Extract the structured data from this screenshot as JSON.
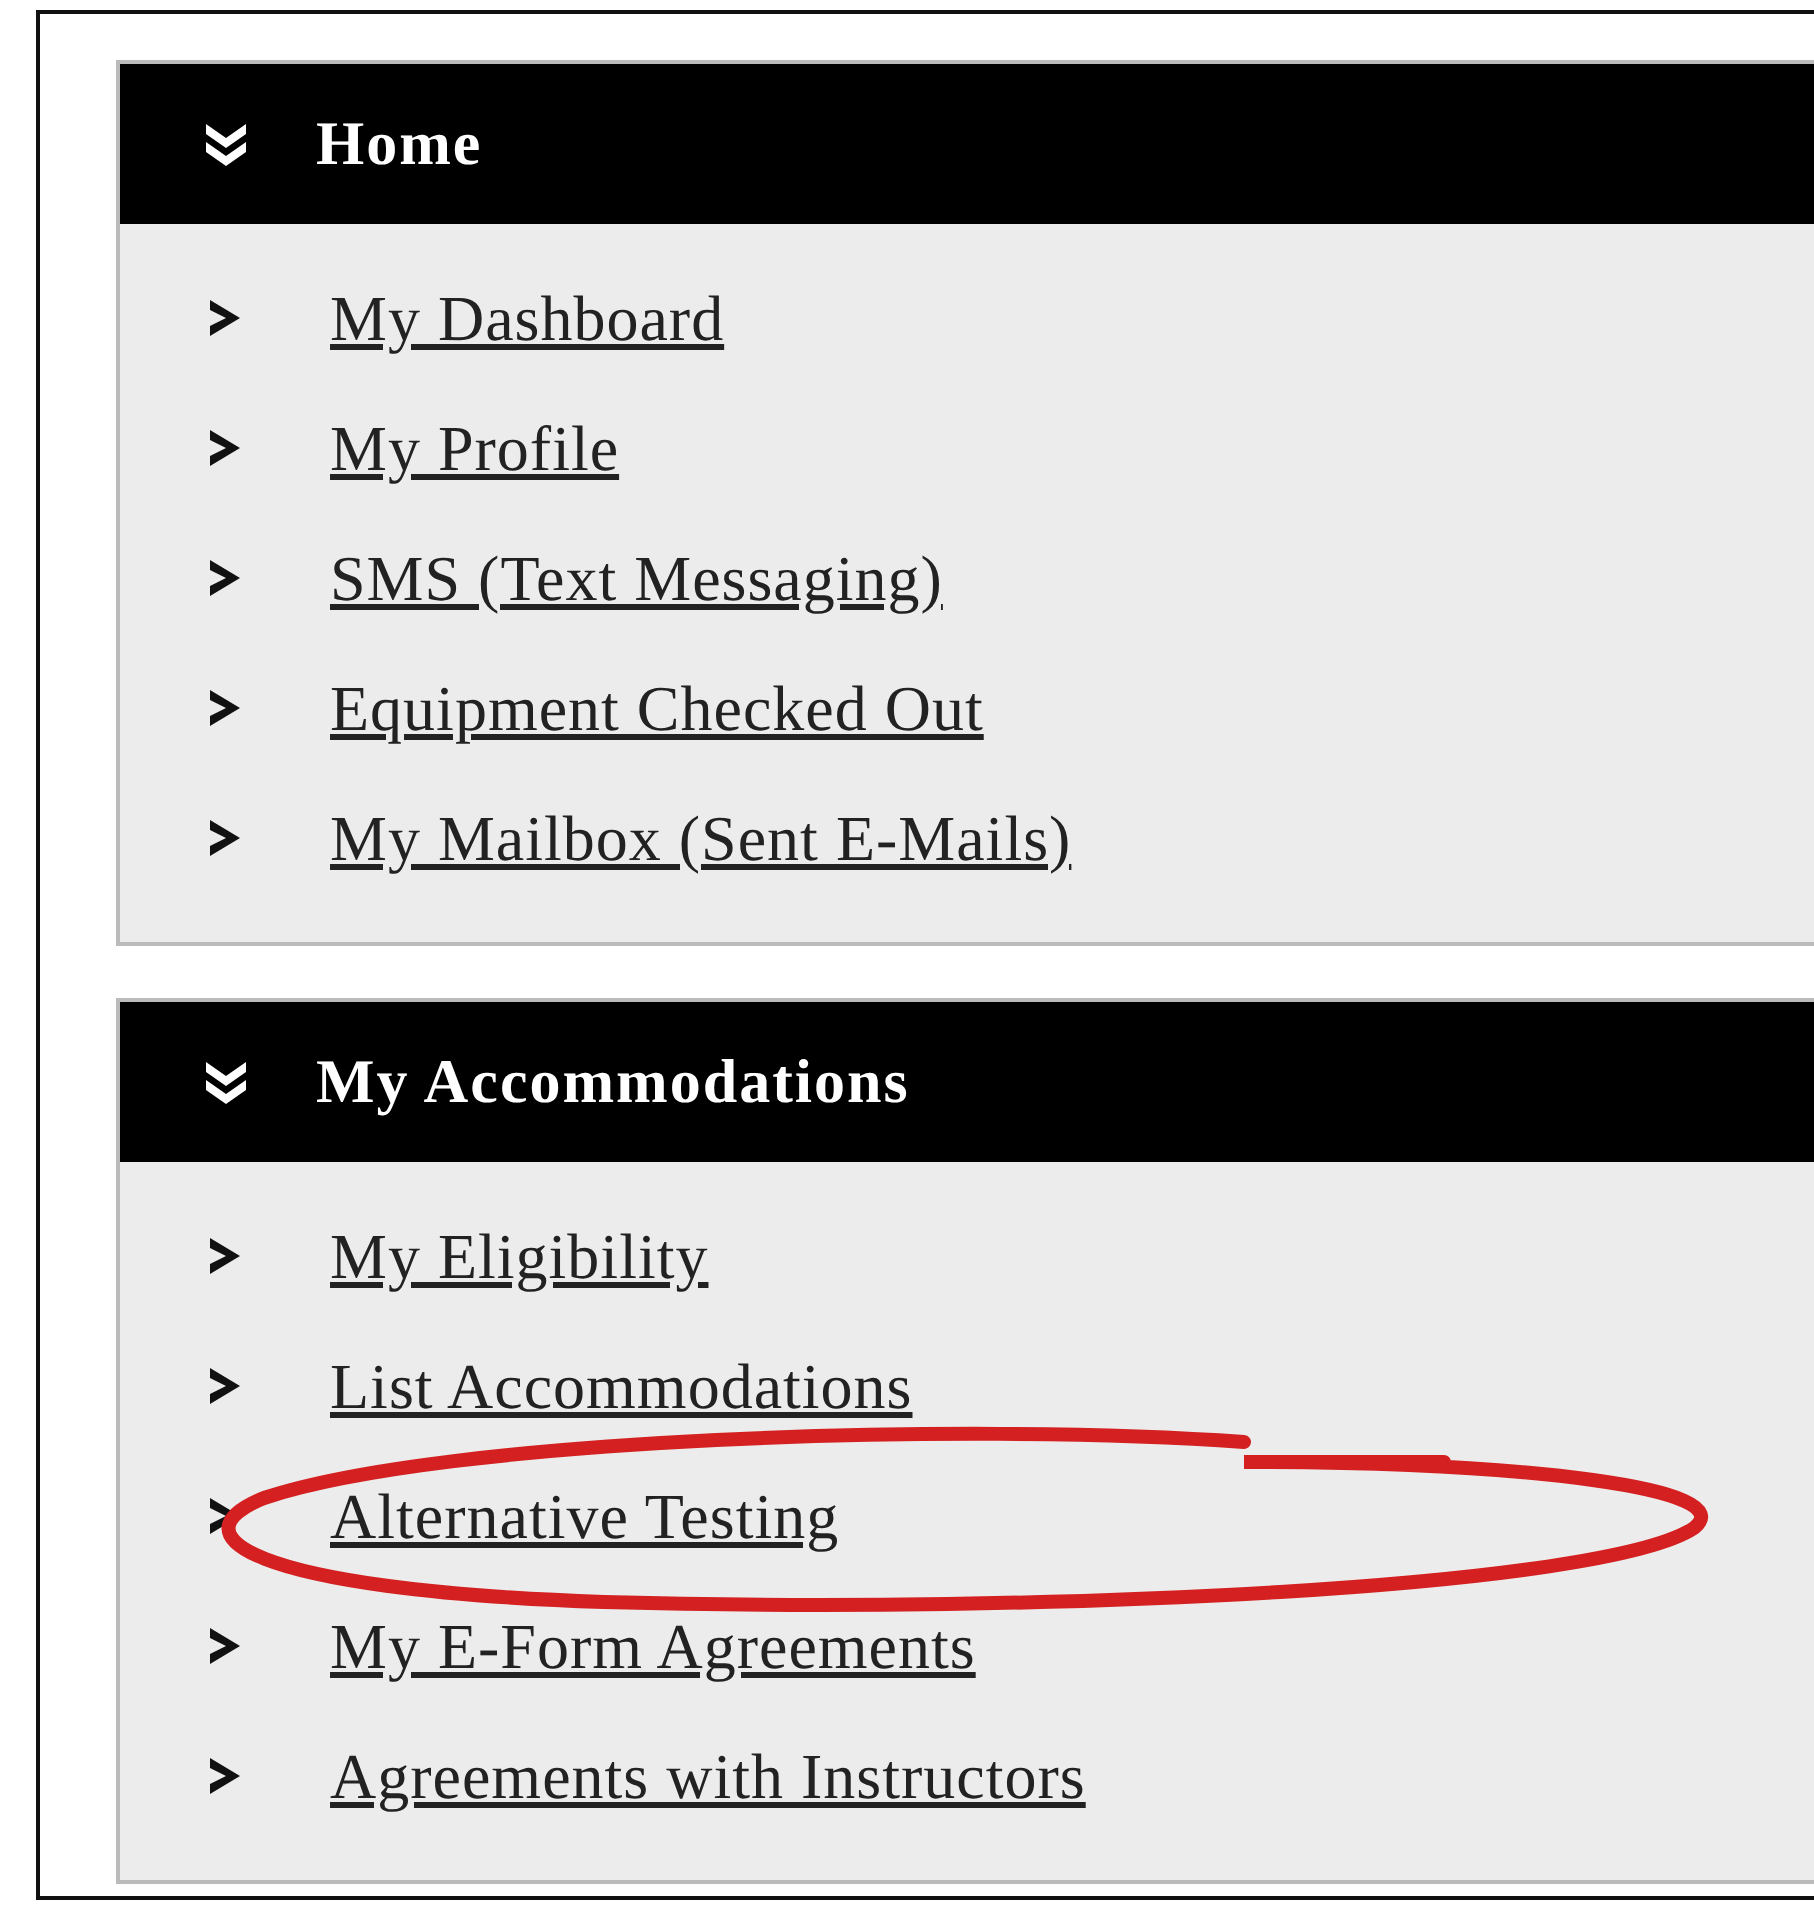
{
  "panels": [
    {
      "title": "Home",
      "items": [
        {
          "label": "My Dashboard",
          "highlighted": false
        },
        {
          "label": "My Profile",
          "highlighted": false
        },
        {
          "label": "SMS (Text Messaging)",
          "highlighted": false
        },
        {
          "label": "Equipment Checked Out",
          "highlighted": false
        },
        {
          "label": "My Mailbox (Sent E-Mails)",
          "highlighted": false
        }
      ]
    },
    {
      "title": "My Accommodations",
      "items": [
        {
          "label": "My Eligibility",
          "highlighted": false
        },
        {
          "label": "List Accommodations",
          "highlighted": false
        },
        {
          "label": "Alternative Testing",
          "highlighted": true
        },
        {
          "label": "My E-Form Agreements",
          "highlighted": false
        },
        {
          "label": "Agreements with Instructors",
          "highlighted": false
        }
      ]
    }
  ]
}
